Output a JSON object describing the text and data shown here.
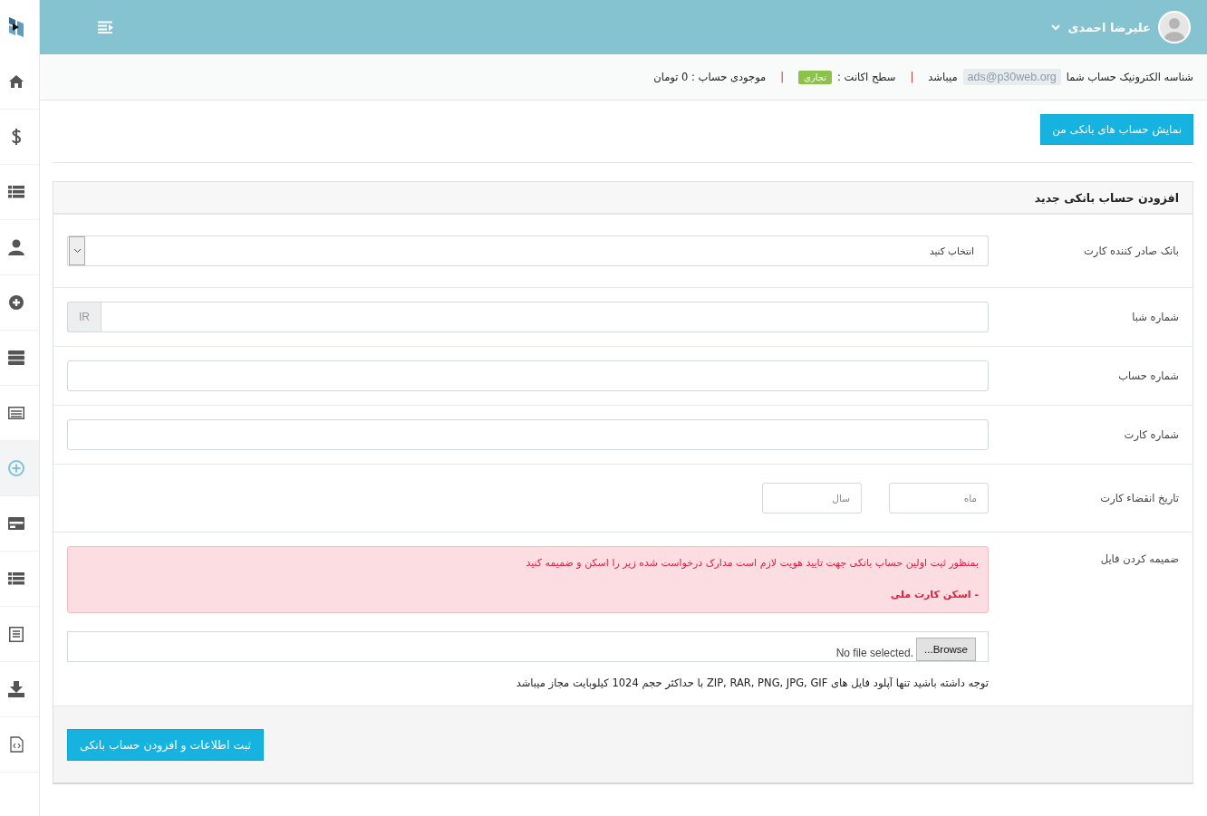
{
  "sidebar": {
    "items": [
      {
        "kind": "home",
        "selected": false
      },
      {
        "kind": "dollar",
        "selected": false
      },
      {
        "kind": "list",
        "selected": false
      },
      {
        "kind": "user",
        "selected": false
      },
      {
        "kind": "plus-circle",
        "selected": false
      },
      {
        "kind": "server",
        "selected": false
      },
      {
        "kind": "window",
        "selected": false
      },
      {
        "kind": "plus-circle-outline",
        "selected": true
      },
      {
        "kind": "card",
        "selected": false
      },
      {
        "kind": "list",
        "selected": false
      },
      {
        "kind": "document",
        "selected": false
      },
      {
        "kind": "download",
        "selected": false
      },
      {
        "kind": "code-file",
        "selected": false
      }
    ]
  },
  "header": {
    "user_name": "علیرضا احمدی"
  },
  "info_bar": {
    "id_label": "شناسه الکترونیک حساب شما",
    "email": "ads@p30web.org",
    "id_suffix": "میباشد",
    "separator_1": "|",
    "level_label": "سطح اکانت :",
    "level_badge": "تجاری",
    "separator_2": "|",
    "balance": "موجودی حساب : 0 تومان"
  },
  "show_accounts_button": "نمایش حساب های بانکی من",
  "panel": {
    "title": "افزودن حساب بانکی جدید",
    "rows": [
      {
        "kind": "select",
        "label": "بانک صادر کننده کارت",
        "value": "انتخاب کنید"
      },
      {
        "kind": "prefixed",
        "label": "شماره شبا",
        "prefix": "IR"
      },
      {
        "kind": "input",
        "label": "شماره حساب"
      },
      {
        "kind": "input",
        "label": "شماره کارت"
      },
      {
        "kind": "expiry",
        "label": "تاریخ انقضاء کارت",
        "month_placeholder": "ماه",
        "year_placeholder": "سال"
      },
      {
        "kind": "file",
        "label": "ضمیمه کردن فایل",
        "alert": "بمنظور ثبت اولین حساب بانکی جهت تایید هویت لازم است مدارک درخواست شده زیر را اسکن و ضمیمه کنید",
        "alert_item": "- اسکن کارت ملی",
        "browse": "Browse...",
        "file_status": "No file selected.",
        "note": "توجه داشته باشید تنها آپلود فایل های ZIP, RAR, PNG, JPG, GIF با حداکثر حجم 1024 کیلوبایت مجاز میباشد"
      }
    ],
    "submit_button": "ثبت اطلاعات و افزودن حساب بانکی"
  }
}
